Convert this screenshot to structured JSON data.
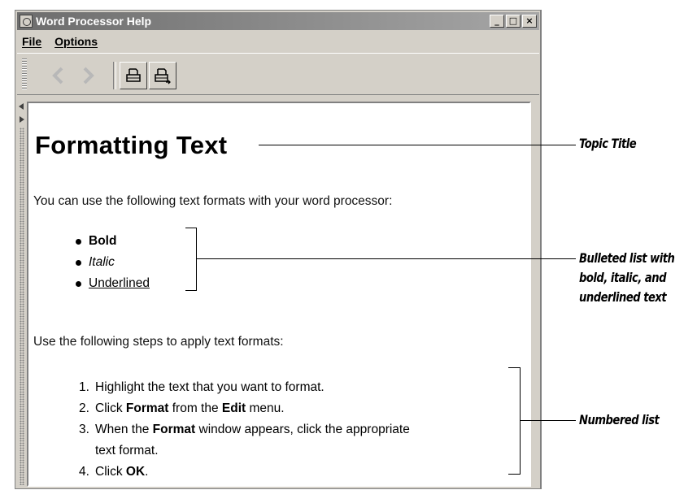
{
  "window": {
    "title": "Word Processor Help",
    "controls": {
      "minimize": "_",
      "maximize": "□",
      "close": "×"
    }
  },
  "menubar": {
    "items": [
      {
        "label": "File"
      },
      {
        "label": "Options"
      }
    ]
  },
  "toolbar": {
    "buttons": [
      {
        "name": "back",
        "icon": "chevron-left-icon"
      },
      {
        "name": "forward",
        "icon": "chevron-right-icon"
      },
      {
        "name": "print",
        "icon": "print-icon"
      },
      {
        "name": "print-setup",
        "icon": "print-setup-icon"
      }
    ]
  },
  "content": {
    "title": "Formatting Text",
    "intro": "You can use the following text formats with your word processor:",
    "bullets": [
      "Bold",
      "Italic",
      "Underlined"
    ],
    "steps_intro": "Use the following steps to apply text formats:",
    "steps": {
      "s1_num": "1.",
      "s1": "Highlight the text that you want to format.",
      "s2_num": "2.",
      "s2_a": "Click ",
      "s2_b": "Format",
      "s2_c": " from the ",
      "s2_d": "Edit",
      "s2_e": " menu.",
      "s3_num": "3.",
      "s3_a": "When the ",
      "s3_b": "Format",
      "s3_c": " window appears, click the appropriate",
      "s3_d": "text format.",
      "s4_num": "4.",
      "s4_a": "Click ",
      "s4_b": "OK",
      "s4_c": "."
    }
  },
  "callouts": {
    "topic_title": "Topic Title",
    "bulleted_list": [
      "Bulleted list with",
      "bold, italic, and",
      "underlined text"
    ],
    "numbered_list": "Numbered list"
  }
}
